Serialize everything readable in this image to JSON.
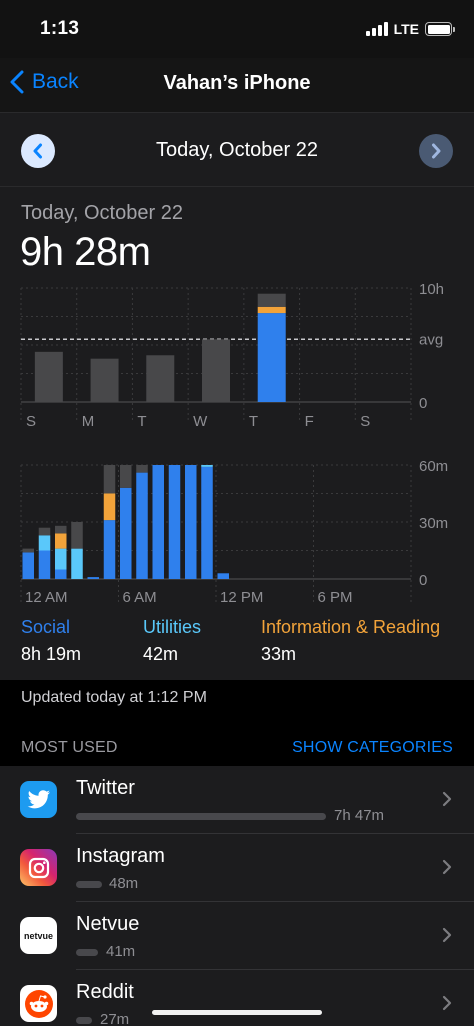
{
  "status_bar": {
    "time": "1:13",
    "network": "LTE"
  },
  "nav": {
    "back_label": "Back",
    "title": "Vahan’s iPhone"
  },
  "date_selector": {
    "label": "Today, October 22"
  },
  "summary": {
    "date": "Today, October 22",
    "total": "9h 28m"
  },
  "colors": {
    "accent": "#0a84ff",
    "social": "#2f80ed",
    "utilities": "#5ac8fa",
    "info_reading": "#f2a33a",
    "other": "#48484a"
  },
  "chart_data": [
    {
      "type": "bar",
      "title": "",
      "categories": [
        "S",
        "M",
        "T",
        "W",
        "T",
        "F",
        "S"
      ],
      "y_tick_labels": [
        "10h",
        "avg",
        "0"
      ],
      "ylim_hours": [
        0,
        10
      ],
      "average_hours": 5.5,
      "series": [
        {
          "name": "Social",
          "values": [
            0,
            0,
            0,
            0,
            7.8,
            0,
            0
          ]
        },
        {
          "name": "Information & Reading",
          "values": [
            0,
            0,
            0,
            0,
            0.55,
            0,
            0
          ]
        },
        {
          "name": "",
          "values": [
            4.4,
            3.8,
            4.1,
            5.5,
            1.15,
            0,
            0
          ]
        }
      ],
      "highlight_index": 4
    },
    {
      "type": "bar",
      "title": "",
      "x_tick_labels": [
        "12 AM",
        "6 AM",
        "12 PM",
        "6 PM"
      ],
      "y_tick_labels": [
        "60m",
        "30m",
        "0"
      ],
      "ylim_minutes": [
        0,
        60
      ],
      "hours": [
        0,
        1,
        2,
        3,
        4,
        5,
        6,
        7,
        8,
        9,
        10,
        11,
        12,
        13,
        14,
        15,
        16,
        17,
        18,
        19,
        20,
        21,
        22,
        23
      ],
      "series": [
        {
          "name": "Social",
          "values": [
            14,
            15,
            5,
            0,
            1,
            31,
            48,
            56,
            60,
            60,
            60,
            59,
            3,
            0,
            0,
            0,
            0,
            0,
            0,
            0,
            0,
            0,
            0,
            0
          ]
        },
        {
          "name": "Utilities",
          "values": [
            0,
            8,
            11,
            16,
            0,
            0,
            0,
            0,
            0,
            0,
            0,
            1,
            0,
            0,
            0,
            0,
            0,
            0,
            0,
            0,
            0,
            0,
            0,
            0
          ]
        },
        {
          "name": "Information & Reading",
          "values": [
            0,
            0,
            8,
            0,
            0,
            14,
            0,
            0,
            0,
            0,
            0,
            0,
            0,
            0,
            0,
            0,
            0,
            0,
            0,
            0,
            0,
            0,
            0,
            0
          ]
        },
        {
          "name": "",
          "values": [
            2,
            4,
            4,
            14,
            0,
            15,
            12,
            4,
            0,
            0,
            0,
            0,
            0,
            0,
            0,
            0,
            0,
            0,
            0,
            0,
            0,
            0,
            0,
            0
          ]
        }
      ]
    }
  ],
  "categories": [
    {
      "name": "Social",
      "value": "8h 19m"
    },
    {
      "name": "Utilities",
      "value": "42m"
    },
    {
      "name": "Information & Reading",
      "value": "33m"
    }
  ],
  "updated": "Updated today at 1:12 PM",
  "most_used": {
    "header": "MOST USED",
    "show_categories": "SHOW CATEGORIES"
  },
  "apps": [
    {
      "name": "Twitter",
      "duration": "7h 47m",
      "icon": "twitter-icon"
    },
    {
      "name": "Instagram",
      "duration": "48m",
      "icon": "instagram-icon"
    },
    {
      "name": "Netvue",
      "duration": "41m",
      "icon": "netvue-icon",
      "icon_text": "netvue"
    },
    {
      "name": "Reddit",
      "duration": "27m",
      "icon": "reddit-icon"
    }
  ]
}
